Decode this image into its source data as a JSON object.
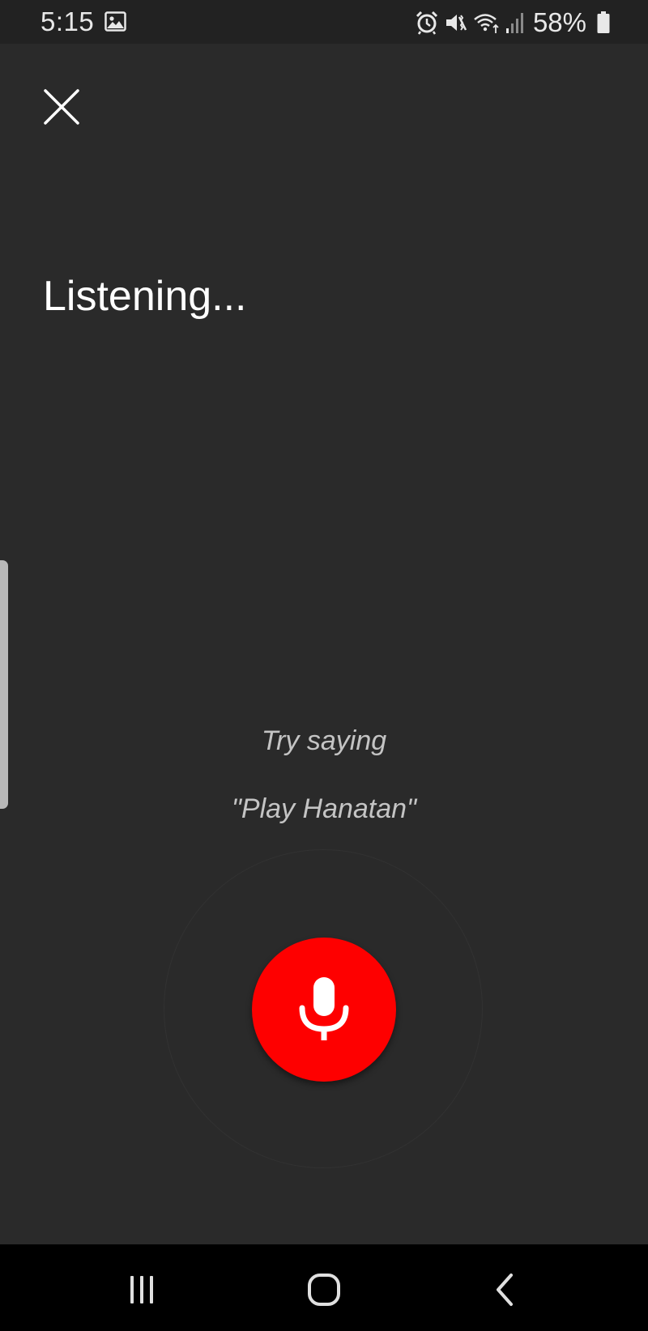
{
  "status_bar": {
    "time": "5:15",
    "battery_percent": "58%",
    "icons": [
      "gallery-icon",
      "alarm-icon",
      "vibrate-mute-icon",
      "wifi-icon",
      "signal-icon",
      "battery-icon"
    ]
  },
  "main": {
    "close_icon": "close-icon",
    "title": "Listening...",
    "hint_label": "Try saying",
    "hint_example": "\"Play Hanatan\"",
    "mic_icon": "microphone-icon"
  },
  "nav_bar": {
    "buttons": [
      "recents-icon",
      "home-icon",
      "back-icon"
    ]
  },
  "colors": {
    "background": "#2a2a2a",
    "status_bar": "#222222",
    "mic_button": "#fe0000",
    "text_primary": "#ffffff",
    "text_hint": "#c4c4c4",
    "nav_bar": "#000000"
  }
}
